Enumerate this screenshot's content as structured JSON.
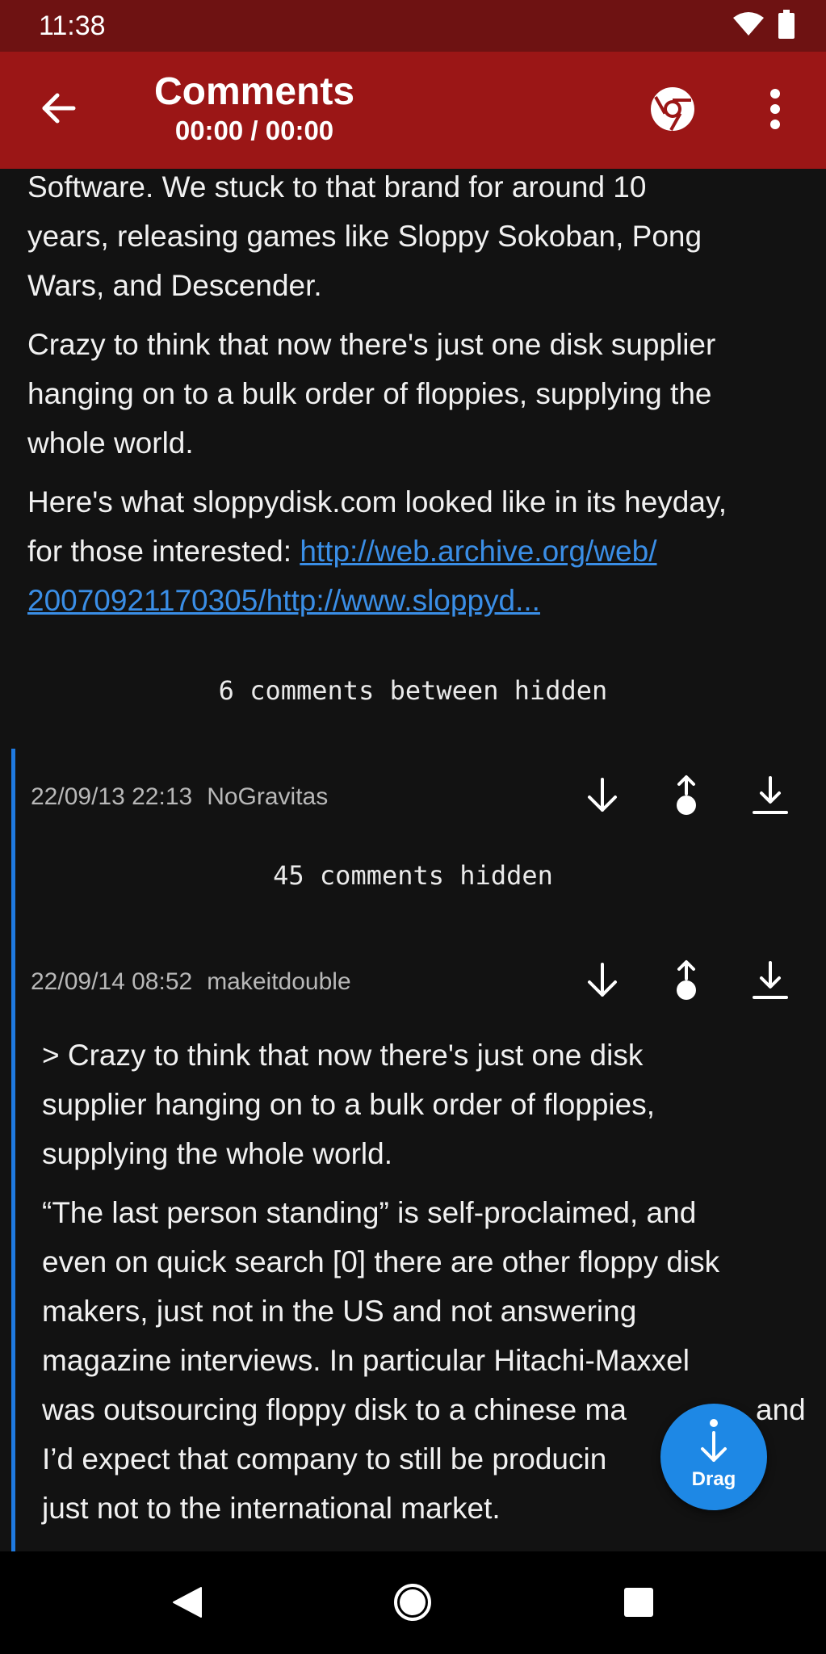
{
  "status_bar": {
    "time": "11:38",
    "icons": [
      "wifi-icon",
      "battery-icon"
    ]
  },
  "app_bar": {
    "title": "Comments",
    "subtitle": "00:00 / 00:00",
    "icons": [
      "back-arrow-icon",
      "chrome-icon",
      "more-vert-icon"
    ]
  },
  "post": {
    "para1_lines": [
      "Software. We stuck to that brand for around 10",
      "years, releasing games like Sloppy Sokoban, Pong",
      "Wars, and Descender."
    ],
    "para2_lines": [
      "Crazy to think that now there's just one disk supplier",
      "hanging on to a bulk order of floppies, supplying the",
      "whole world."
    ],
    "para3_line1": "Here's what sloppydisk.com looked like in its heyday,",
    "para3_line2_text": "for those interested: ",
    "para3_link_part1": "http://web.archive.org/web/",
    "para3_link_part2": "20070921170305/http://www.sloppyd..."
  },
  "hidden_between": "6 comments between hidden",
  "comments": [
    {
      "date": "22/09/13 22:13",
      "author": "NoGravitas",
      "hidden_note": "45 comments hidden"
    },
    {
      "date": "22/09/14 08:52",
      "author": "makeitdouble",
      "quote_lines": [
        "> Crazy to think that now there's just one disk",
        "supplier hanging on to a bulk order of floppies,",
        "supplying the whole world."
      ],
      "body_lines": [
        "“The last person standing” is self-proclaimed, and",
        "even on quick search [0] there are other floppy disk",
        "makers, just not in the US and not answering",
        "magazine interviews. In particular Hitachi-Maxxel",
        "was outsourcing floppy disk to a chinese ma",
        "I’d expect that company to still be producin",
        "just not to the international market."
      ],
      "body_line5_tail": "and"
    }
  ],
  "fab": {
    "label": "Drag",
    "color": "#1e88e5"
  },
  "colors": {
    "status_bar": "#6e1212",
    "app_bar": "#9b1616",
    "background": "#121212",
    "link": "#3a8ee6",
    "thread_line": "#1f7ae0"
  },
  "nav_bar": {
    "icons": [
      "back-triangle-icon",
      "home-circle-icon",
      "recents-square-icon"
    ]
  }
}
